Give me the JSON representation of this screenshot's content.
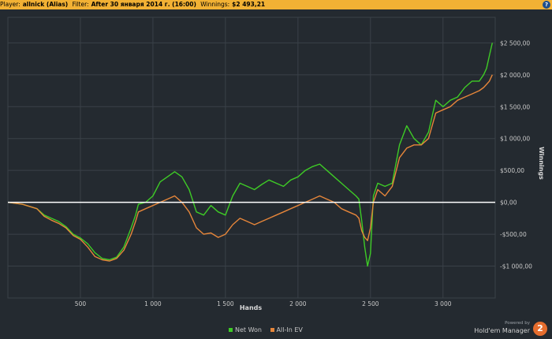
{
  "header": {
    "player_label": "Player:",
    "player_value": "allnick (Alias)",
    "filter_label": "Filter:",
    "filter_value": "After 30 января 2014 г. (16:00)",
    "winnings_label": "Winnings:",
    "winnings_value": "$2 493,21",
    "help_glyph": "?"
  },
  "legend": {
    "net_won": "Net Won",
    "allin_ev": "All-In EV"
  },
  "branding": {
    "powered_by": "Powered by",
    "name": "Hold'em Manager",
    "logo_text": "2"
  },
  "colors": {
    "background": "#242a30",
    "header": "#f2b134",
    "net_won": "#3ecb26",
    "allin_ev": "#e6863a",
    "zero_line": "#ffffff",
    "grid": "#3a4148"
  },
  "chart_data": {
    "type": "line",
    "xlabel": "Hands",
    "ylabel": "Winnings",
    "xlim": [
      0,
      3360
    ],
    "ylim": [
      -1500,
      2900
    ],
    "x_ticks": [
      500,
      1000,
      1500,
      2000,
      2500,
      3000
    ],
    "x_tick_labels": [
      "500",
      "1 000",
      "1 500",
      "2 000",
      "2 500",
      "3 000"
    ],
    "y_ticks": [
      2500,
      2000,
      1500,
      1000,
      500,
      0,
      -500,
      -1000
    ],
    "y_tick_labels": [
      "$2 500,00",
      "$2 000,00",
      "$1 500,00",
      "$1 000,00",
      "$500,00",
      "$0,00",
      "-$500,00",
      "-$1 000,00"
    ],
    "grid": true,
    "legend_position": "bottom-center",
    "series": [
      {
        "name": "Net Won",
        "color": "#3ecb26",
        "x": [
          0,
          100,
          200,
          250,
          300,
          350,
          400,
          450,
          500,
          550,
          600,
          650,
          700,
          750,
          800,
          850,
          880,
          900,
          950,
          1000,
          1050,
          1100,
          1150,
          1200,
          1250,
          1300,
          1350,
          1400,
          1450,
          1500,
          1550,
          1600,
          1650,
          1700,
          1750,
          1800,
          1850,
          1900,
          1950,
          2000,
          2050,
          2100,
          2150,
          2200,
          2250,
          2300,
          2350,
          2400,
          2420,
          2440,
          2460,
          2480,
          2500,
          2520,
          2550,
          2600,
          2650,
          2700,
          2750,
          2800,
          2850,
          2900,
          2950,
          3000,
          3050,
          3100,
          3150,
          3200,
          3250,
          3280,
          3300,
          3320,
          3340
        ],
        "values": [
          0,
          -30,
          -100,
          -200,
          -250,
          -300,
          -380,
          -500,
          -560,
          -650,
          -790,
          -880,
          -900,
          -860,
          -700,
          -400,
          -200,
          -30,
          0,
          100,
          320,
          400,
          480,
          400,
          200,
          -150,
          -200,
          -50,
          -150,
          -200,
          100,
          300,
          250,
          200,
          280,
          350,
          300,
          250,
          350,
          400,
          500,
          560,
          600,
          500,
          400,
          300,
          200,
          100,
          50,
          -300,
          -700,
          -1000,
          -800,
          100,
          300,
          250,
          300,
          900,
          1200,
          1000,
          900,
          1100,
          1600,
          1500,
          1600,
          1650,
          1800,
          1900,
          1900,
          2000,
          2100,
          2300,
          2500
        ]
      },
      {
        "name": "All-In EV",
        "color": "#e6863a",
        "x": [
          0,
          100,
          200,
          250,
          300,
          350,
          400,
          450,
          500,
          550,
          600,
          650,
          700,
          750,
          800,
          850,
          880,
          900,
          950,
          1000,
          1050,
          1100,
          1150,
          1200,
          1250,
          1300,
          1350,
          1400,
          1450,
          1500,
          1550,
          1600,
          1650,
          1700,
          1750,
          1800,
          1850,
          1900,
          1950,
          2000,
          2050,
          2100,
          2150,
          2200,
          2250,
          2300,
          2350,
          2400,
          2420,
          2440,
          2460,
          2480,
          2500,
          2520,
          2550,
          2600,
          2650,
          2700,
          2750,
          2800,
          2850,
          2900,
          2950,
          3000,
          3050,
          3100,
          3150,
          3200,
          3250,
          3280,
          3300,
          3320,
          3340
        ],
        "values": [
          0,
          -30,
          -100,
          -220,
          -280,
          -330,
          -400,
          -520,
          -580,
          -700,
          -850,
          -900,
          -920,
          -880,
          -750,
          -500,
          -300,
          -150,
          -100,
          -50,
          0,
          50,
          100,
          0,
          -150,
          -400,
          -500,
          -480,
          -550,
          -500,
          -350,
          -250,
          -300,
          -350,
          -300,
          -250,
          -200,
          -150,
          -100,
          -50,
          0,
          50,
          100,
          50,
          0,
          -100,
          -150,
          -200,
          -250,
          -450,
          -550,
          -600,
          -400,
          0,
          200,
          100,
          250,
          700,
          850,
          900,
          900,
          1000,
          1400,
          1450,
          1500,
          1600,
          1650,
          1700,
          1750,
          1800,
          1850,
          1900,
          2000
        ]
      }
    ]
  }
}
